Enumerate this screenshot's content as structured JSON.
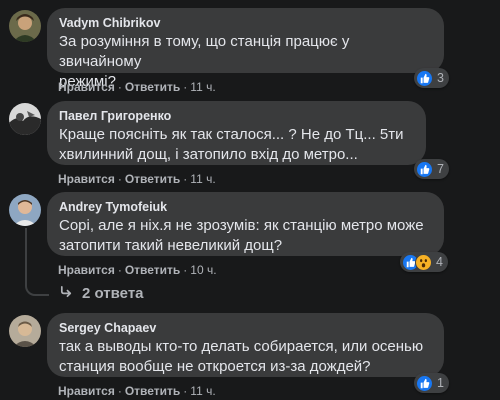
{
  "comments": [
    {
      "author": "Vadym Chibrikov",
      "line1": "За розуміння в тому, що станція працює у звичайному",
      "line2": "режимі?",
      "like": "Нравится",
      "reply": "Ответить",
      "time": "11 ч.",
      "reactions": [
        "like"
      ],
      "count": "3"
    },
    {
      "author": "Павел Григоренко",
      "line1": "Краще поясніть як так сталося... ? Не до Тц... 5ти",
      "line2": "хвилинний дощ, і затопило вхід до метро...",
      "like": "Нравится",
      "reply": "Ответить",
      "time": "11 ч.",
      "reactions": [
        "like"
      ],
      "count": "7"
    },
    {
      "author": "Andrey Tymofeiuk",
      "line1": "Сорі, але я ніх.я не зрозумів: як станцію метро може",
      "line2": "затопити такий невеликий дощ?",
      "like": "Нравится",
      "reply": "Ответить",
      "time": "10 ч.",
      "reactions": [
        "like",
        "wow"
      ],
      "count": "4"
    },
    {
      "author": "Sergey Chapaev",
      "line1": "так а выводы кто-то делать собирается, или осенью",
      "line2": "станция вообще не откроется из-за дождей?",
      "like": "Нравится",
      "reply": "Ответить",
      "time": "11 ч.",
      "reactions": [
        "like"
      ],
      "count": "1"
    }
  ],
  "replies_link": "2 ответа",
  "colors": {
    "background": "#18191a",
    "bubble": "#3a3b3c",
    "text": "#e4e6eb",
    "secondary": "#b0b3b8",
    "like": "#1877f2",
    "wow": "#f7b125"
  }
}
